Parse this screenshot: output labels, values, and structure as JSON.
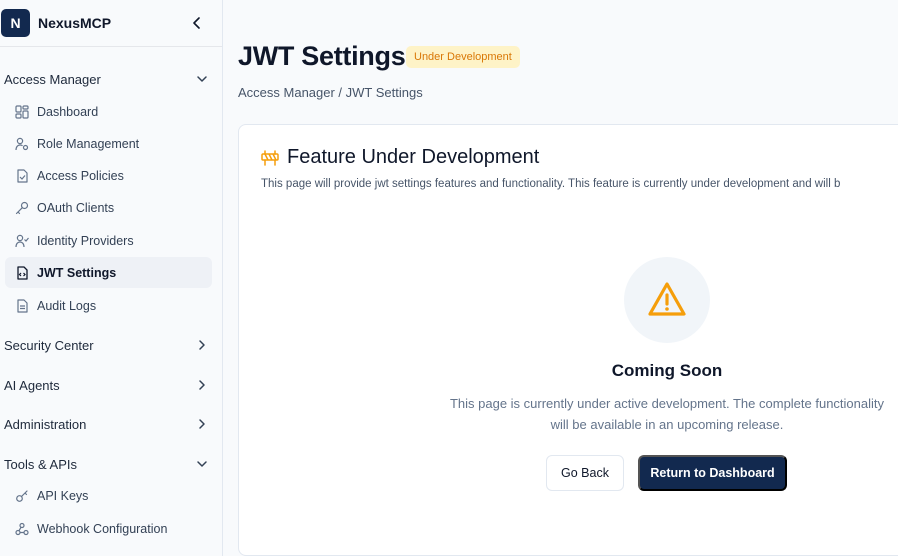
{
  "brand": {
    "logo_letter": "N",
    "name": "NexusMCP"
  },
  "sidebar": {
    "sections": [
      {
        "label": "Access Manager",
        "expanded": true
      },
      {
        "label": "Security Center",
        "expanded": false
      },
      {
        "label": "AI Agents",
        "expanded": false
      },
      {
        "label": "Administration",
        "expanded": false
      },
      {
        "label": "Tools & APIs",
        "expanded": true
      }
    ],
    "access_items": [
      {
        "label": "Dashboard",
        "icon": "dashboard-icon"
      },
      {
        "label": "Role Management",
        "icon": "user-cog-icon"
      },
      {
        "label": "Access Policies",
        "icon": "file-check-icon"
      },
      {
        "label": "OAuth Clients",
        "icon": "key-icon"
      },
      {
        "label": "Identity Providers",
        "icon": "user-check-icon"
      },
      {
        "label": "JWT Settings",
        "icon": "file-code-icon",
        "active": true
      },
      {
        "label": "Audit Logs",
        "icon": "file-text-icon"
      }
    ],
    "tools_items": [
      {
        "label": "API Keys",
        "icon": "key-round-icon"
      },
      {
        "label": "Webhook Configuration",
        "icon": "webhook-icon"
      }
    ]
  },
  "page": {
    "title": "JWT Settings",
    "badge": "Under Development",
    "breadcrumb": "Access Manager / JWT Settings"
  },
  "card": {
    "title": "Feature Under Development",
    "description": "This page will provide jwt settings features and functionality. This feature is currently under development and will b",
    "coming_title": "Coming Soon",
    "coming_text": "This page is currently under active development. The complete functionality will be available in an upcoming release.",
    "back_label": "Go Back",
    "dashboard_label": "Return to Dashboard"
  },
  "colors": {
    "brand": "#12294f",
    "warning": "#f59e0b",
    "badge_bg": "#fef3c7",
    "badge_text": "#d97706"
  }
}
